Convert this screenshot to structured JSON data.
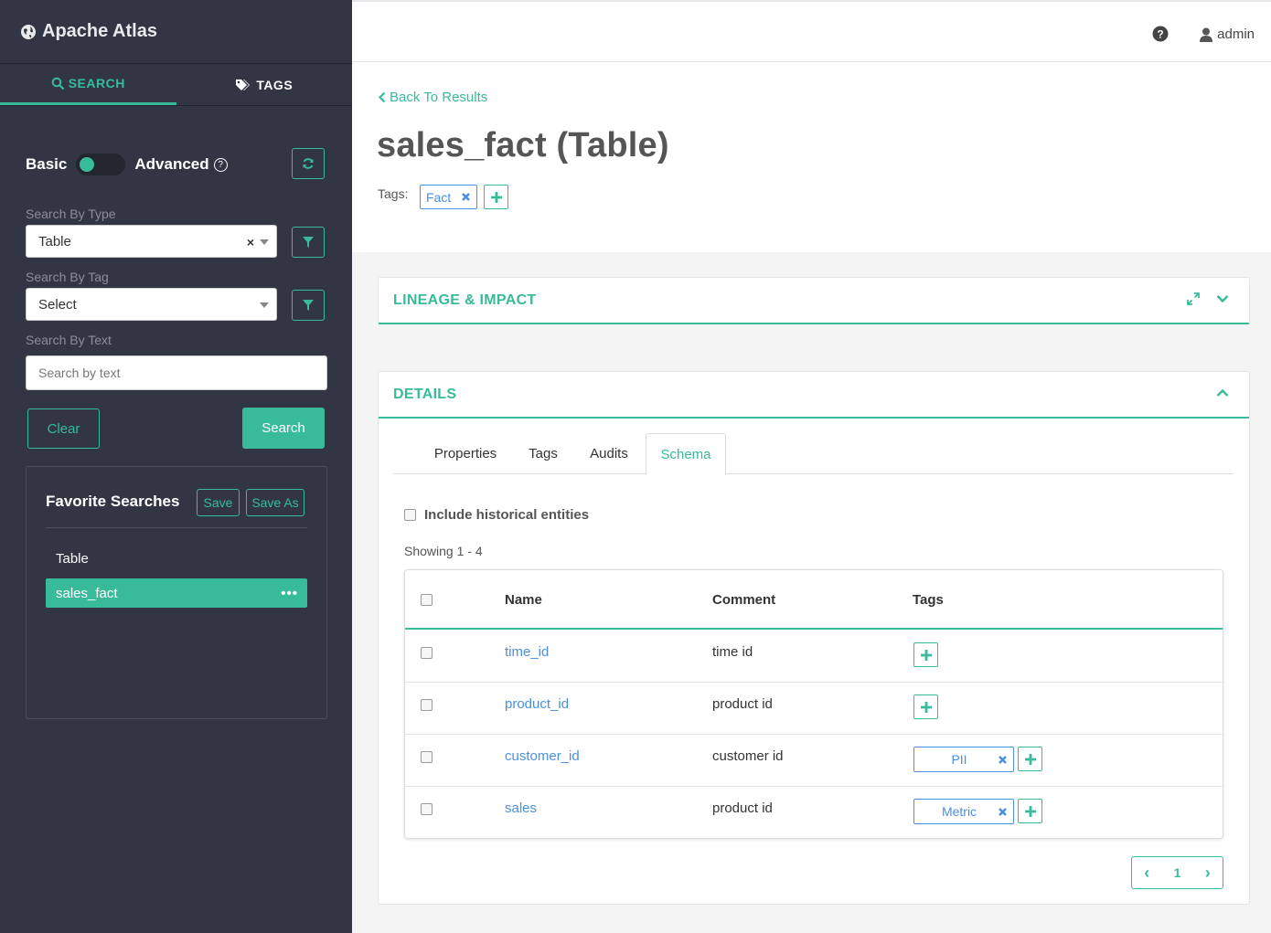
{
  "brand": {
    "name": "Apache Atlas",
    "icon": "globe-icon"
  },
  "sidebar": {
    "tabs": [
      {
        "label": "SEARCH",
        "icon": "search-icon",
        "active": true
      },
      {
        "label": "TAGS",
        "icon": "tags-icon",
        "active": false
      }
    ],
    "toggle": {
      "left_label": "Basic",
      "right_label": "Advanced",
      "help": "?"
    },
    "search_by_type": {
      "label": "Search By Type",
      "value": "Table",
      "clear": "×"
    },
    "search_by_tag": {
      "label": "Search By Tag",
      "value": "Select"
    },
    "search_by_text": {
      "label": "Search By Text",
      "placeholder": "Search by text"
    },
    "clear_label": "Clear",
    "search_label": "Search",
    "favorites": {
      "title": "Favorite Searches",
      "save_label": "Save",
      "save_as_label": "Save As",
      "items": [
        {
          "label": "Table",
          "active": false
        },
        {
          "label": "sales_fact",
          "active": true,
          "more": "•••"
        }
      ]
    }
  },
  "topbar": {
    "help_icon": "question-circle-icon",
    "user": "admin"
  },
  "entity": {
    "back_label": "Back To Results",
    "title": "sales_fact (Table)",
    "tags_label": "Tags:",
    "tags": [
      "Fact"
    ]
  },
  "lineage_panel": {
    "title": "LINEAGE & IMPACT"
  },
  "details_panel": {
    "title": "DETAILS",
    "tabs": [
      {
        "label": "Properties",
        "active": false
      },
      {
        "label": "Tags",
        "active": false
      },
      {
        "label": "Audits",
        "active": false
      },
      {
        "label": "Schema",
        "active": true
      }
    ],
    "include_historical": "Include historical entities",
    "showing": "Showing 1 - 4",
    "columns": {
      "name": "Name",
      "comment": "Comment",
      "tags": "Tags"
    },
    "rows": [
      {
        "name": "time_id",
        "comment": "time id",
        "tag": ""
      },
      {
        "name": "product_id",
        "comment": "product id",
        "tag": ""
      },
      {
        "name": "customer_id",
        "comment": "customer id",
        "tag": "PII"
      },
      {
        "name": "sales",
        "comment": "product id",
        "tag": "Metric"
      }
    ],
    "pager": {
      "prev": "‹",
      "page": "1",
      "next": "›"
    }
  },
  "colors": {
    "accent": "#38bb9b",
    "sidebar_bg": "#323544",
    "link": "#4a90e2"
  }
}
